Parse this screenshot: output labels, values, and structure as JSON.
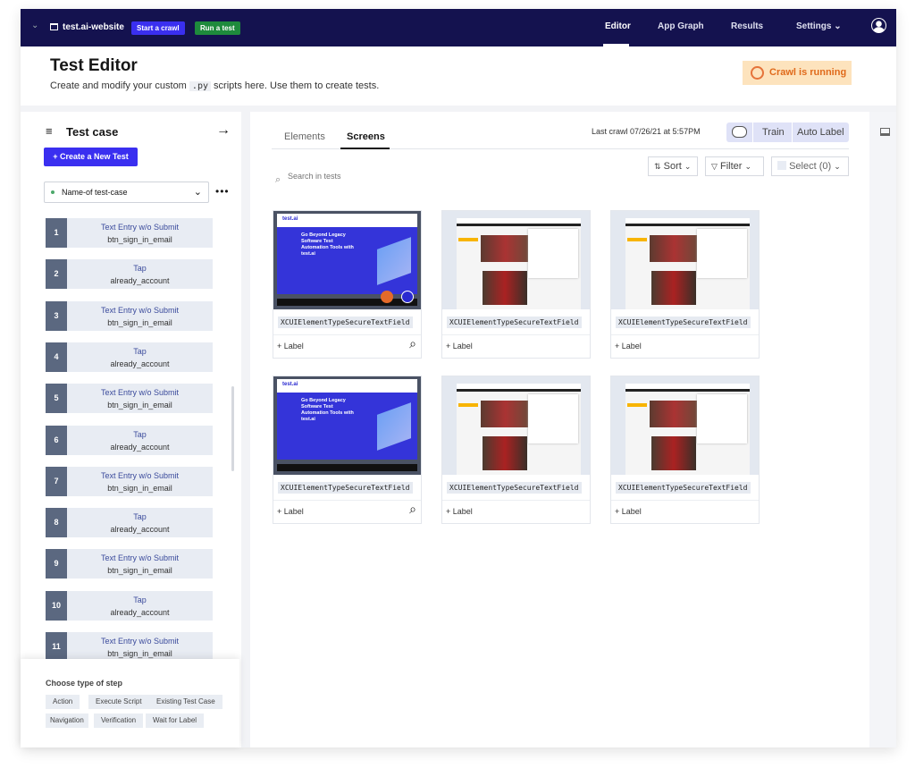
{
  "nav": {
    "project": "test.ai-website",
    "start_crawl": "Start a crawl",
    "run_test": "Run a test",
    "tabs": [
      "Editor",
      "App Graph",
      "Results",
      "Settings"
    ],
    "active_tab": "Editor"
  },
  "header": {
    "title": "Test Editor",
    "subtitle_pre": "Create and modify your custom",
    "subtitle_code": ".py",
    "subtitle_post": "scripts here. Use them to create tests.",
    "crawl_status": "Crawl is running"
  },
  "sidebar": {
    "title": "Test case",
    "create_button": "+ Create a New Test",
    "test_case": "Name-of test-case",
    "steps": [
      {
        "n": "1",
        "type": "Text Entry w/o Submit",
        "target": "btn_sign_in_email"
      },
      {
        "n": "2",
        "type": "Tap",
        "target": "already_account"
      },
      {
        "n": "3",
        "type": "Text Entry w/o Submit",
        "target": "btn_sign_in_email"
      },
      {
        "n": "4",
        "type": "Tap",
        "target": "already_account"
      },
      {
        "n": "5",
        "type": "Text Entry w/o Submit",
        "target": "btn_sign_in_email"
      },
      {
        "n": "6",
        "type": "Tap",
        "target": "already_account"
      },
      {
        "n": "7",
        "type": "Text Entry w/o Submit",
        "target": "btn_sign_in_email"
      },
      {
        "n": "8",
        "type": "Tap",
        "target": "already_account"
      },
      {
        "n": "9",
        "type": "Text Entry w/o Submit",
        "target": "btn_sign_in_email"
      },
      {
        "n": "10",
        "type": "Tap",
        "target": "already_account"
      },
      {
        "n": "11",
        "type": "Text Entry w/o Submit",
        "target": "btn_sign_in_email"
      }
    ],
    "step_types_title": "Choose type of step",
    "step_types": [
      "Action",
      "Execute Script",
      "Existing Test Case",
      "Navigation",
      "Verification",
      "Wait for Label"
    ]
  },
  "main": {
    "tabs": [
      "Elements",
      "Screens"
    ],
    "active_tab": "Screens",
    "last_crawl": "Last crawl 07/26/21 at 5:57PM",
    "train": "Train",
    "auto_label": "Auto Label",
    "search_placeholder": "Search in tests",
    "sort": "Sort",
    "filter": "Filter",
    "select": "Select (0)",
    "thumb_text": {
      "logo": "test.ai",
      "headline": "Go Beyond Legacy Software Test Automation Tools with test.ai"
    },
    "cards": [
      {
        "name": "XCUIElementTypeSecureTextField",
        "label": "+ Label",
        "kind": "testai"
      },
      {
        "name": "XCUIElementTypeSecureTextField",
        "label": "+ Label",
        "kind": "sports"
      },
      {
        "name": "XCUIElementTypeSecureTextField",
        "label": "+ Label",
        "kind": "sports"
      },
      {
        "name": "XCUIElementTypeSecureTextField",
        "label": "+ Label",
        "kind": "testai"
      },
      {
        "name": "XCUIElementTypeSecureTextField",
        "label": "+ Label",
        "kind": "sports"
      },
      {
        "name": "XCUIElementTypeSecureTextField",
        "label": "+ Label",
        "kind": "sports"
      }
    ]
  },
  "colors": {
    "nav": "#14124f",
    "primary": "#3a2ff0",
    "green": "#1e8a3c",
    "crawl_bg": "#fde3bd",
    "crawl_fg": "#e06a1b"
  }
}
